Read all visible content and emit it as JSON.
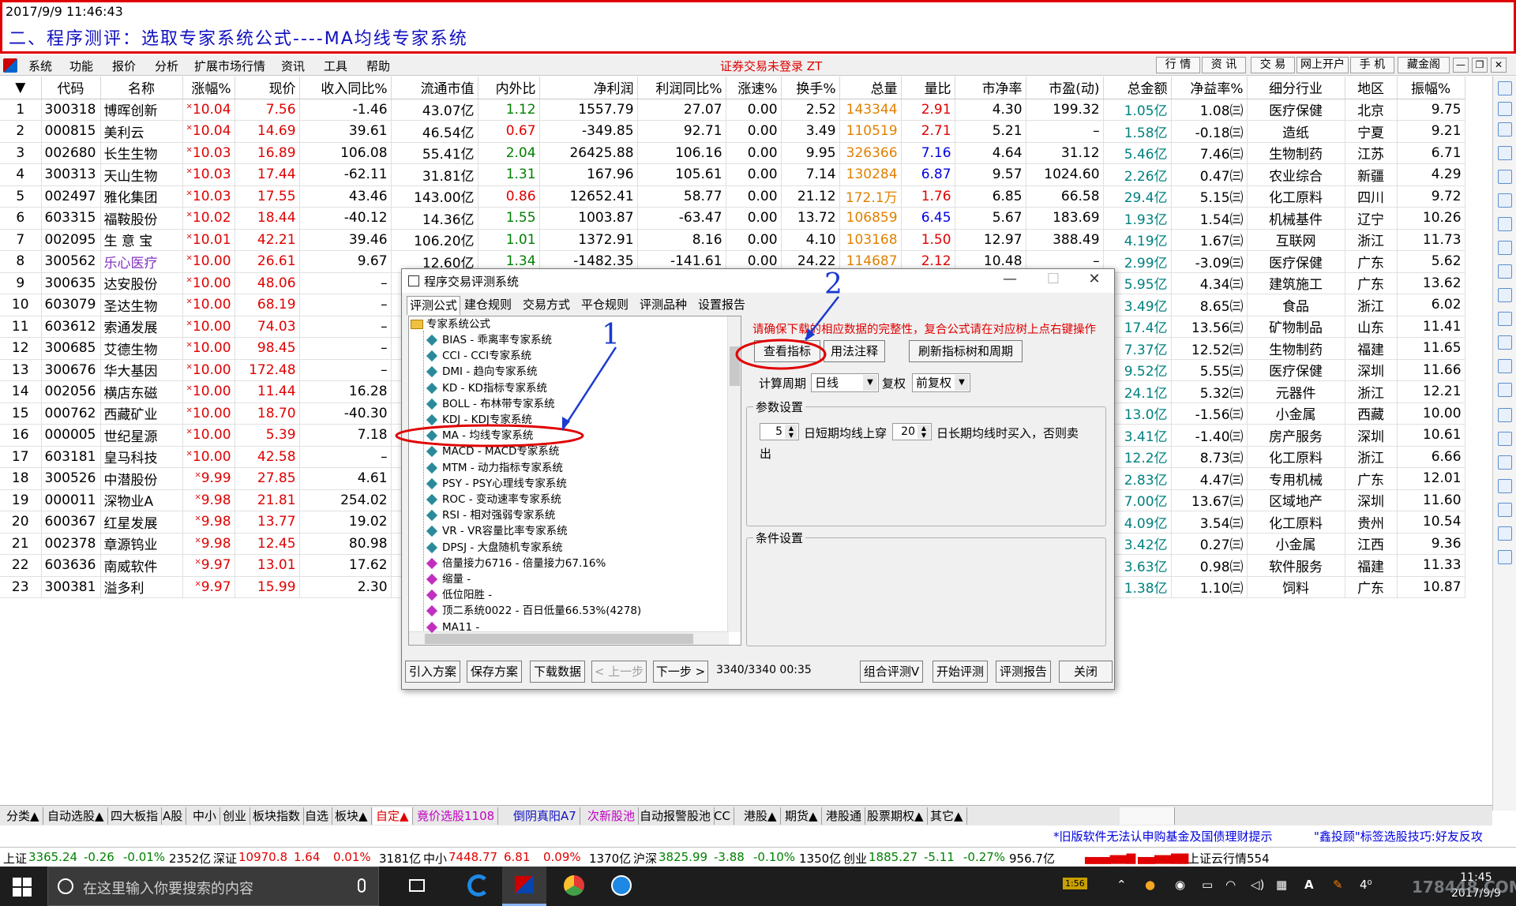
{
  "banner": {
    "timestamp": "2017/9/9 11:46:43",
    "title": "二、程序测评：选取专家系统公式----MA均线专家系统"
  },
  "menu": {
    "items": [
      "系统",
      "功能",
      "报价",
      "分析",
      "扩展市场行情",
      "资讯",
      "工具",
      "帮助"
    ],
    "status": "证券交易未登录  ZT",
    "right_buttons": [
      "行 情",
      "资 讯",
      "交 易",
      "网上开户",
      "手 机",
      "藏金阁"
    ]
  },
  "table": {
    "headers": [
      "",
      "代码",
      "名称",
      "涨幅%",
      "现价",
      "收入同比%",
      "流通市值",
      "内外比",
      "净利润",
      "利润同比%",
      "涨速%",
      "换手%",
      "总量",
      "量比",
      "市净率",
      "市盈(动)",
      "总金额",
      "净益率%",
      "细分行业",
      "地区",
      "振幅%"
    ],
    "rows": [
      [
        "1",
        "300318",
        "博晖创新",
        "10.04",
        "7.56",
        "-1.46",
        "43.07亿",
        "1.12",
        "1557.79",
        "27.07",
        "0.00",
        "2.52",
        "143344",
        "2.91",
        "4.30",
        "199.32",
        "1.05亿",
        "1.08㈢",
        "医疗保健",
        "北京",
        "9.75"
      ],
      [
        "2",
        "000815",
        "美利云",
        "10.04",
        "14.69",
        "39.61",
        "46.54亿",
        "0.67",
        "-349.85",
        "92.71",
        "0.00",
        "3.49",
        "110519",
        "2.71",
        "5.21",
        "–",
        "1.58亿",
        "-0.18㈢",
        "造纸",
        "宁夏",
        "9.21"
      ],
      [
        "3",
        "002680",
        "长生生物",
        "10.03",
        "16.89",
        "106.08",
        "55.41亿",
        "2.04",
        "26425.88",
        "106.16",
        "0.00",
        "9.95",
        "326366",
        "7.16",
        "4.64",
        "31.12",
        "5.46亿",
        "7.46㈢",
        "生物制药",
        "江苏",
        "6.71"
      ],
      [
        "4",
        "300313",
        "天山生物",
        "10.03",
        "17.44",
        "-62.11",
        "31.81亿",
        "1.31",
        "167.96",
        "105.61",
        "0.00",
        "7.14",
        "130284",
        "6.87",
        "9.57",
        "1024.60",
        "2.26亿",
        "0.47㈢",
        "农业综合",
        "新疆",
        "4.29"
      ],
      [
        "5",
        "002497",
        "雅化集团",
        "10.03",
        "17.55",
        "43.46",
        "143.00亿",
        "0.86",
        "12652.41",
        "58.77",
        "0.00",
        "21.12",
        "172.1万",
        "1.76",
        "6.85",
        "66.58",
        "29.4亿",
        "5.15㈢",
        "化工原料",
        "四川",
        "9.72"
      ],
      [
        "6",
        "603315",
        "福鞍股份",
        "10.02",
        "18.44",
        "-40.12",
        "14.36亿",
        "1.55",
        "1003.87",
        "-63.47",
        "0.00",
        "13.72",
        "106859",
        "6.45",
        "5.67",
        "183.69",
        "1.93亿",
        "1.54㈢",
        "机械基件",
        "辽宁",
        "10.26"
      ],
      [
        "7",
        "002095",
        "生 意 宝",
        "10.01",
        "42.21",
        "39.46",
        "106.20亿",
        "1.01",
        "1372.91",
        "8.16",
        "0.00",
        "4.10",
        "103168",
        "1.50",
        "12.97",
        "388.49",
        "4.19亿",
        "1.67㈢",
        "互联网",
        "浙江",
        "11.73"
      ],
      [
        "8",
        "300562",
        "乐心医疗",
        "10.00",
        "26.61",
        "9.67",
        "12.60亿",
        "1.34",
        "-1482.35",
        "-141.61",
        "0.00",
        "24.22",
        "114687",
        "2.12",
        "10.48",
        "–",
        "2.99亿",
        "-3.09㈢",
        "医疗保健",
        "广东",
        "5.62"
      ],
      [
        "9",
        "300635",
        "达安股份",
        "10.00",
        "48.06",
        "–",
        "",
        "",
        "",
        "",
        "",
        "",
        "",
        "",
        "",
        "",
        "5.95亿",
        "4.34㈢",
        "建筑施工",
        "广东",
        "13.62"
      ],
      [
        "10",
        "603079",
        "圣达生物",
        "10.00",
        "68.19",
        "–",
        "",
        "",
        "",
        "",
        "",
        "",
        "",
        "",
        "",
        "",
        "3.49亿",
        "8.65㈢",
        "食品",
        "浙江",
        "6.02"
      ],
      [
        "11",
        "603612",
        "索通发展",
        "10.00",
        "74.03",
        "–",
        "",
        "",
        "",
        "",
        "",
        "",
        "",
        "",
        "",
        "",
        "17.4亿",
        "13.56㈢",
        "矿物制品",
        "山东",
        "11.41"
      ],
      [
        "12",
        "300685",
        "艾德生物",
        "10.00",
        "98.45",
        "–",
        "",
        "",
        "",
        "",
        "",
        "",
        "",
        "",
        "",
        "",
        "7.37亿",
        "12.52㈢",
        "生物制药",
        "福建",
        "11.65"
      ],
      [
        "13",
        "300676",
        "华大基因",
        "10.00",
        "172.48",
        "–",
        "",
        "",
        "",
        "",
        "",
        "",
        "",
        "",
        "",
        "",
        "9.52亿",
        "5.55㈢",
        "医疗保健",
        "深圳",
        "11.66"
      ],
      [
        "14",
        "002056",
        "横店东磁",
        "10.00",
        "11.44",
        "16.28",
        "",
        "",
        "",
        "",
        "",
        "",
        "",
        "",
        "",
        "",
        "24.1亿",
        "5.32㈢",
        "元器件",
        "浙江",
        "12.21"
      ],
      [
        "15",
        "000762",
        "西藏矿业",
        "10.00",
        "18.70",
        "-40.30",
        "",
        "",
        "",
        "",
        "",
        "",
        "",
        "",
        "",
        "",
        "13.0亿",
        "-1.56㈢",
        "小金属",
        "西藏",
        "10.00"
      ],
      [
        "16",
        "000005",
        "世纪星源",
        "10.00",
        "5.39",
        "7.18",
        "",
        "",
        "",
        "",
        "",
        "",
        "",
        "",
        "",
        "",
        "3.41亿",
        "-1.40㈢",
        "房产服务",
        "深圳",
        "10.61"
      ],
      [
        "17",
        "603181",
        "皇马科技",
        "10.00",
        "42.58",
        "–",
        "",
        "",
        "",
        "",
        "",
        "",
        "",
        "",
        "",
        "",
        "12.2亿",
        "8.73㈢",
        "化工原料",
        "浙江",
        "6.66"
      ],
      [
        "18",
        "300526",
        "中潜股份",
        "9.99",
        "27.85",
        "4.61",
        "",
        "",
        "",
        "",
        "",
        "",
        "",
        "",
        "",
        "",
        "2.83亿",
        "4.47㈢",
        "专用机械",
        "广东",
        "12.01"
      ],
      [
        "19",
        "000011",
        "深物业A",
        "9.98",
        "21.81",
        "254.02",
        "",
        "",
        "",
        "",
        "",
        "",
        "",
        "",
        "",
        "",
        "7.00亿",
        "13.67㈢",
        "区域地产",
        "深圳",
        "11.60"
      ],
      [
        "20",
        "600367",
        "红星发展",
        "9.98",
        "13.77",
        "19.02",
        "",
        "",
        "",
        "",
        "",
        "",
        "",
        "",
        "",
        "",
        "4.09亿",
        "3.54㈢",
        "化工原料",
        "贵州",
        "10.54"
      ],
      [
        "21",
        "002378",
        "章源钨业",
        "9.98",
        "12.45",
        "80.98",
        "",
        "",
        "",
        "",
        "",
        "",
        "",
        "",
        "",
        "",
        "3.42亿",
        "0.27㈢",
        "小金属",
        "江西",
        "9.36"
      ],
      [
        "22",
        "603636",
        "南威软件",
        "9.97",
        "13.01",
        "17.62",
        "",
        "",
        "",
        "",
        "",
        "",
        "",
        "",
        "",
        "",
        "3.63亿",
        "0.98㈢",
        "软件服务",
        "福建",
        "11.33"
      ],
      [
        "23",
        "300381",
        "溢多利",
        "9.97",
        "15.99",
        "2.30",
        "",
        "",
        "",
        "",
        "",
        "",
        "",
        "",
        "",
        "",
        "1.38亿",
        "1.10㈢",
        "饲料",
        "广东",
        "10.87"
      ]
    ]
  },
  "bottom_tabs": [
    "分类▲",
    "自动选股▲",
    "四大板指",
    "A股",
    "中小",
    "创业",
    "板块指数",
    "自选",
    "板块▲",
    "自定▲",
    "竟价选股1108",
    "倒阴真阳A7",
    "次新股池",
    "自动报警股池",
    "CC",
    "港股▲",
    "期货▲",
    "港股通",
    "股票期权▲",
    "其它▲"
  ],
  "ticker1": {
    "left": "*旧版软件无法认申购基金及国债理财提示",
    "right": "\"鑫投顾\"标签选股技巧:好友反攻"
  },
  "ticker2": [
    {
      "label": "上证",
      "value": "3365.24",
      "chg": "-0.26",
      "pct": "-0.01%",
      "amt": "2352亿"
    },
    {
      "label": "深证",
      "value": "10970.8",
      "chg": "1.64",
      "pct": "0.01%",
      "amt": "3181亿"
    },
    {
      "label": "中小",
      "value": "7448.77",
      "chg": "6.81",
      "pct": "0.09%",
      "amt": "1370亿"
    },
    {
      "label": "沪深",
      "value": "3825.99",
      "chg": "-3.88",
      "pct": "-0.10%",
      "amt": "1350亿"
    },
    {
      "label": "创业",
      "value": "1885.27",
      "chg": "-5.11",
      "pct": "-0.27%",
      "amt": "956.7亿"
    }
  ],
  "ticker2_right": "上证云行情554",
  "dialog": {
    "title": "程序交易评测系统",
    "tabs": [
      "评测公式",
      "建仓规则",
      "交易方式",
      "平仓规则",
      "评测品种",
      "设置报告"
    ],
    "tree_root": "专家系统公式",
    "tree_items": [
      "BIAS - 乖离率专家系统",
      "CCI - CCI专家系统",
      "DMI - 趋向专家系统",
      "KD - KD指标专家系统",
      "BOLL - 布林带专家系统",
      "KDJ - KDJ专家系统",
      "MA - 均线专家系统",
      "MACD - MACD专家系统",
      "MTM - 动力指标专家系统",
      "PSY - PSY心理线专家系统",
      "ROC - 变动速率专家系统",
      "RSI - 相对强弱专家系统",
      "VR - VR容量比率专家系统",
      "DPSJ - 大盘随机专家系统",
      "倍量接力6716 - 倍量接力67.16%",
      "缩量 -",
      "低位阳胜 -",
      "顶二系统0022 - 百日低量66.53%(4278)",
      "MA11 -"
    ],
    "warning": "请确保下载的相应数据的完整性，复合公式请在对应树上点右键操作",
    "btn_view": "查看指标",
    "btn_usage": "用法注释",
    "btn_refresh": "刷新指标树和周期",
    "period_label": "计算周期",
    "period_value": "日线",
    "fq_label": "复权",
    "fq_value": "前复权",
    "params_label": "参数设置",
    "param1": "5",
    "param2": "20",
    "param_text1": "日短期均线上穿",
    "param_text2": "日长期均线时买入，否则卖",
    "param_text3": "出",
    "cond_label": "条件设置",
    "buttons": [
      "引入方案",
      "保存方案",
      "下载数据",
      "< 上一步",
      "下一步 >"
    ],
    "progress": "3340/3340 00:35",
    "buttons_right": [
      "组合评测V",
      "开始评测",
      "评测报告",
      "关闭"
    ]
  },
  "annotations": {
    "a1": "1",
    "a2": "2"
  },
  "taskbar": {
    "search": "在这里输入你要搜索的内容",
    "time": "11:45",
    "date": "2017/9/9",
    "watermark": "178448.COM"
  }
}
